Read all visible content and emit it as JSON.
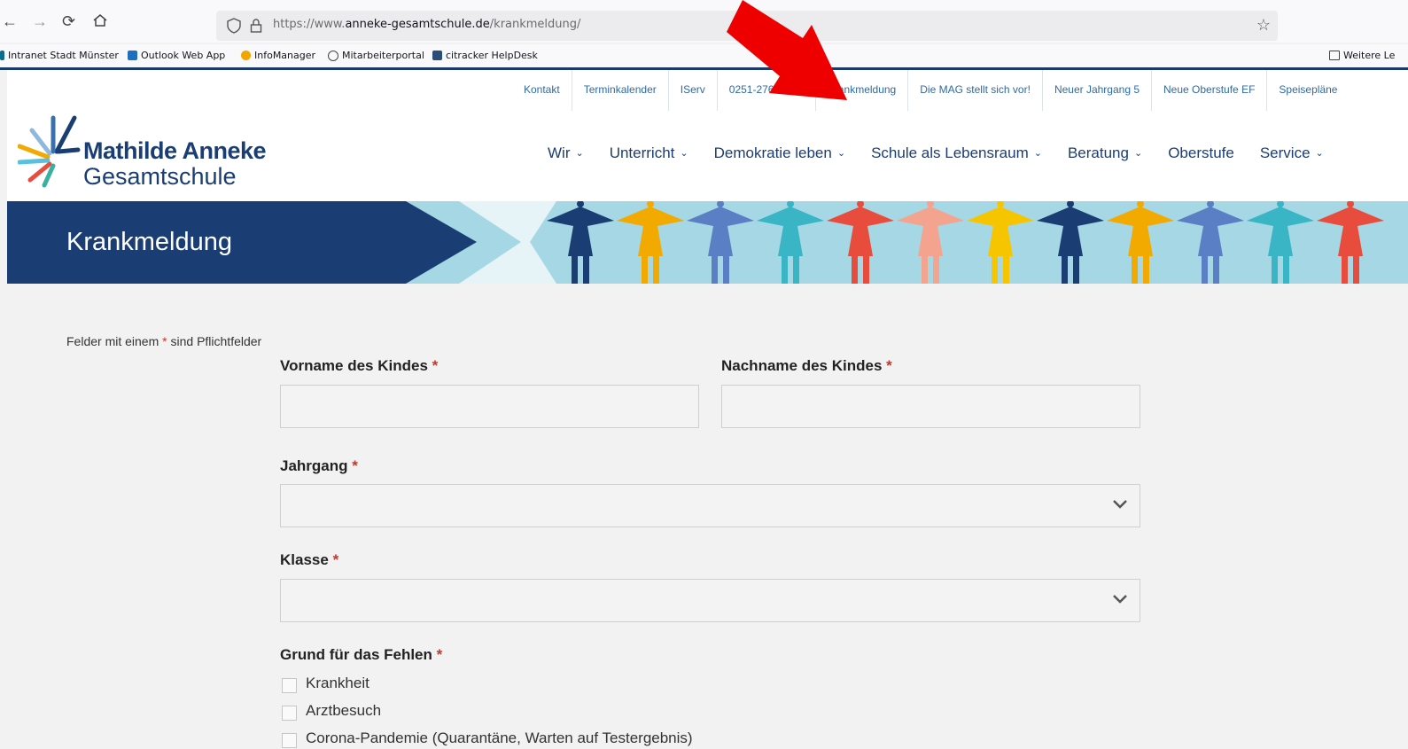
{
  "browser": {
    "url_prefix": "https://www.",
    "url_domain": "anneke-gesamtschule.de",
    "url_path": "/krankmeldung/",
    "bookmarks": [
      "Intranet Stadt Münster",
      "Outlook Web App",
      "InfoManager",
      "Mitarbeiterportal",
      "citracker HelpDesk"
    ],
    "other_bookmarks": "Weitere Le"
  },
  "meta_nav": [
    "Kontakt",
    "Terminkalender",
    "IServ",
    "0251-276 60 10",
    "Krankmeldung",
    "Die MAG stellt sich vor!",
    "Neuer Jahrgang 5",
    "Neue Oberstufe EF",
    "Speisepläne"
  ],
  "logo": {
    "line1": "Mathilde Anneke",
    "line2": "Gesamtschule"
  },
  "main_nav": [
    {
      "label": "Wir",
      "dropdown": true
    },
    {
      "label": "Unterricht",
      "dropdown": true
    },
    {
      "label": "Demokratie leben",
      "dropdown": true
    },
    {
      "label": "Schule als Lebensraum",
      "dropdown": true
    },
    {
      "label": "Beratung",
      "dropdown": true
    },
    {
      "label": "Oberstufe",
      "dropdown": false
    },
    {
      "label": "Service",
      "dropdown": true
    }
  ],
  "page_title": "Krankmeldung",
  "form": {
    "hint_before": "Felder mit einem ",
    "hint_star": "*",
    "hint_after": " sind Pflichtfelder",
    "first_name_label": "Vorname des Kindes",
    "first_name_value": "",
    "last_name_label": "Nachname des Kindes",
    "last_name_value": "",
    "year_label": "Jahrgang",
    "year_value": "",
    "class_label": "Klasse",
    "class_value": "",
    "reason_label": "Grund für das Fehlen",
    "reasons": [
      "Krankheit",
      "Arztbesuch",
      "Corona-Pandemie (Quarantäne, Warten auf Testergebnis)"
    ],
    "required_star": "*"
  },
  "colors": {
    "brand_navy": "#1a3e73",
    "banner_bg": "#a5d7e4",
    "required": "#c0392b",
    "annotation_arrow": "#ee0000"
  }
}
